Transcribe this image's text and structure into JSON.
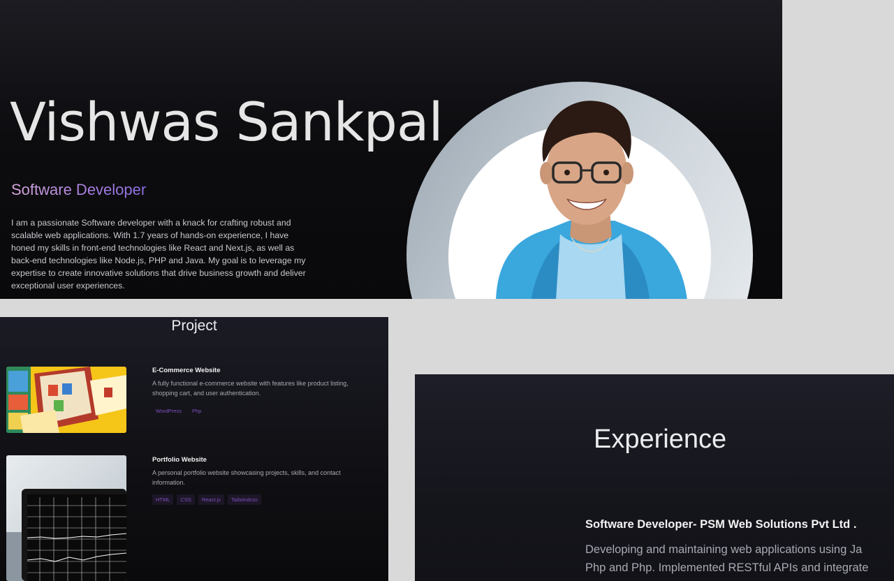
{
  "hero": {
    "name": "Vishwas Sankpal",
    "role": "Software Developer",
    "bio": "I am a passionate Software developer with a knack for crafting robust and scalable web applications. With 1.7 years of hands-on experience, I have honed my skills in front-end technologies like React and Next.js, as well as back-end technologies like Node.js, PHP and Java. My goal is to leverage my expertise to create innovative solutions that drive business growth and deliver exceptional user experiences."
  },
  "projects": {
    "title": "Project",
    "items": [
      {
        "name": "E-Commerce Website",
        "description": "A fully functional e-commerce website with features like product listing, shopping cart, and user authentication.",
        "tags": [
          "WordPress",
          "Php"
        ]
      },
      {
        "name": "Portfolio Website",
        "description": "A personal portfolio website showcasing projects, skills, and contact information.",
        "tags": [
          "HTML",
          "CSS",
          "React.js",
          "Tailwindcss"
        ]
      }
    ]
  },
  "experience": {
    "title": "Experience",
    "role": "Software Developer- PSM Web Solutions Pvt Ltd .",
    "description_lines": [
      "Developing and maintaining web applications using Ja",
      "Php and Php. Implemented RESTful APIs and integrate"
    ]
  },
  "colors": {
    "hero_bg": "#0d0d10",
    "role_gradient_start": "#d6a7dc",
    "role_gradient_end": "#8a6fe0",
    "tag_text": "#7f4fc0",
    "page_bg": "#d9d9d9"
  },
  "icons": [
    "profile-photo",
    "ecommerce-thumbnail",
    "portfolio-thumbnail"
  ]
}
